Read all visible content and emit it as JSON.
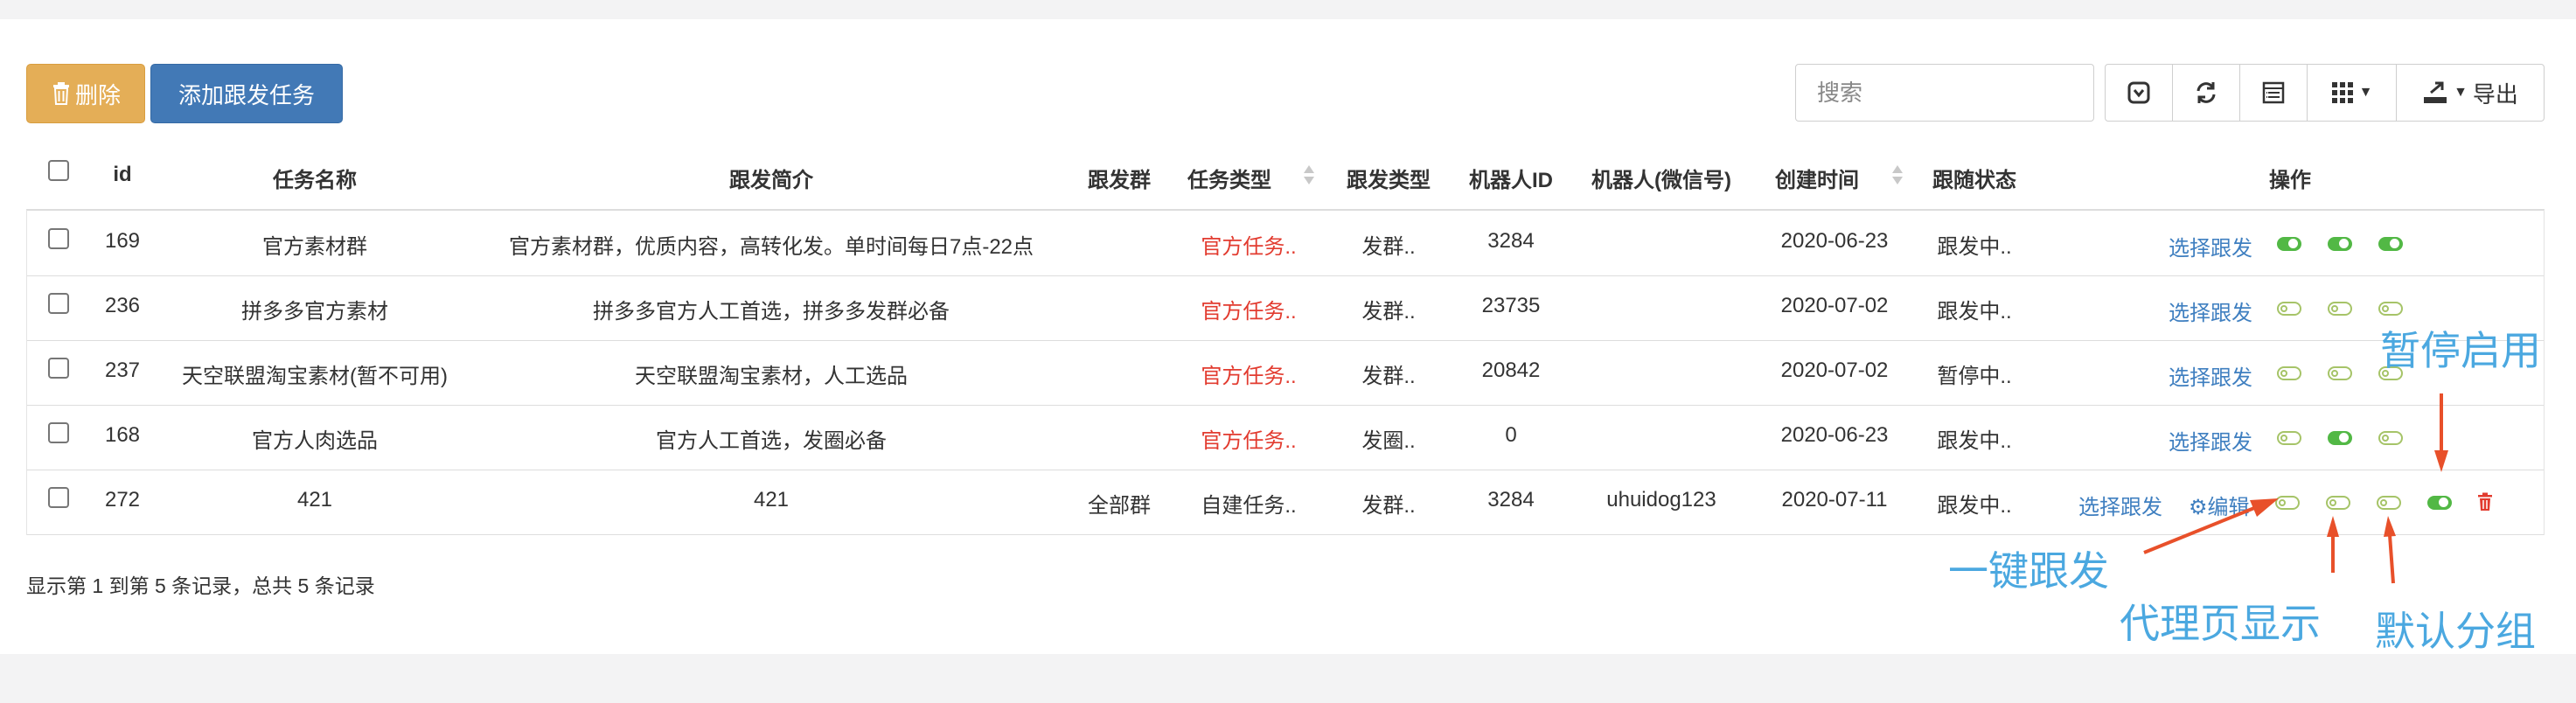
{
  "toolbar": {
    "delete_label": "删除",
    "add_label": "添加跟发任务",
    "search_placeholder": "搜索",
    "export_label": "导出"
  },
  "icons": {
    "trash": "trash-icon",
    "toggle_view": "toggle-view-icon",
    "refresh": "refresh-icon",
    "list": "list-icon",
    "columns": "grid-columns-icon",
    "export": "export-icon",
    "gear": "gear-icon"
  },
  "table": {
    "headers": [
      "id",
      "任务名称",
      "跟发简介",
      "跟发群",
      "任务类型",
      "跟发类型",
      "机器人ID",
      "机器人(微信号)",
      "创建时间",
      "跟随状态",
      "操作"
    ],
    "rows": [
      {
        "id": "169",
        "name": "官方素材群",
        "intro": "官方素材群，优质内容，高转化发。单时间每日7点-22点",
        "group": "",
        "task_type": "官方任务..",
        "follow_type": "发群..",
        "robot_id": "3284",
        "robot_wx": "",
        "created": "2020-06-23",
        "status": "跟发中..",
        "select_label": "选择跟发",
        "edit_label": "",
        "toggles": [
          true,
          true,
          true
        ]
      },
      {
        "id": "236",
        "name": "拼多多官方素材",
        "intro": "拼多多官方人工首选，拼多多发群必备",
        "group": "",
        "task_type": "官方任务..",
        "follow_type": "发群..",
        "robot_id": "23735",
        "robot_wx": "",
        "created": "2020-07-02",
        "status": "跟发中..",
        "select_label": "选择跟发",
        "edit_label": "",
        "toggles": [
          false,
          false,
          false
        ]
      },
      {
        "id": "237",
        "name": "天空联盟淘宝素材(暂不可用)",
        "intro": "天空联盟淘宝素材，人工选品",
        "group": "",
        "task_type": "官方任务..",
        "follow_type": "发群..",
        "robot_id": "20842",
        "robot_wx": "",
        "created": "2020-07-02",
        "status": "暂停中..",
        "select_label": "选择跟发",
        "edit_label": "",
        "toggles": [
          false,
          false,
          false
        ]
      },
      {
        "id": "168",
        "name": "官方人肉选品",
        "intro": "官方人工首选，发圈必备",
        "group": "",
        "task_type": "官方任务..",
        "follow_type": "发圈..",
        "robot_id": "0",
        "robot_wx": "",
        "created": "2020-06-23",
        "status": "跟发中..",
        "select_label": "选择跟发",
        "edit_label": "",
        "toggles": [
          false,
          true,
          false
        ]
      },
      {
        "id": "272",
        "name": "421",
        "intro": "421",
        "group": "全部群",
        "task_type": "自建任务..",
        "follow_type": "发群..",
        "robot_id": "3284",
        "robot_wx": "uhuidog123",
        "created": "2020-07-11",
        "status": "跟发中..",
        "select_label": "选择跟发",
        "edit_label": "编辑",
        "toggles": [
          false,
          false,
          false,
          true
        ]
      }
    ]
  },
  "footer": {
    "summary": "显示第 1 到第 5 条记录，总共 5 条记录"
  },
  "annotations": {
    "pause_enable": "暂停启用",
    "one_click": "一键跟发",
    "proxy_page": "代理页显示",
    "default_group": "默认分组",
    "color": "#4ba8e0",
    "arrow_color": "#e8502a"
  },
  "colors": {
    "delete_button": "#e4ae57",
    "add_button": "#4279b6",
    "red_text": "#e23b2f",
    "link": "#3f7fc0",
    "toggle_on": "#52b845",
    "toggle_off_border": "#a6c468"
  }
}
